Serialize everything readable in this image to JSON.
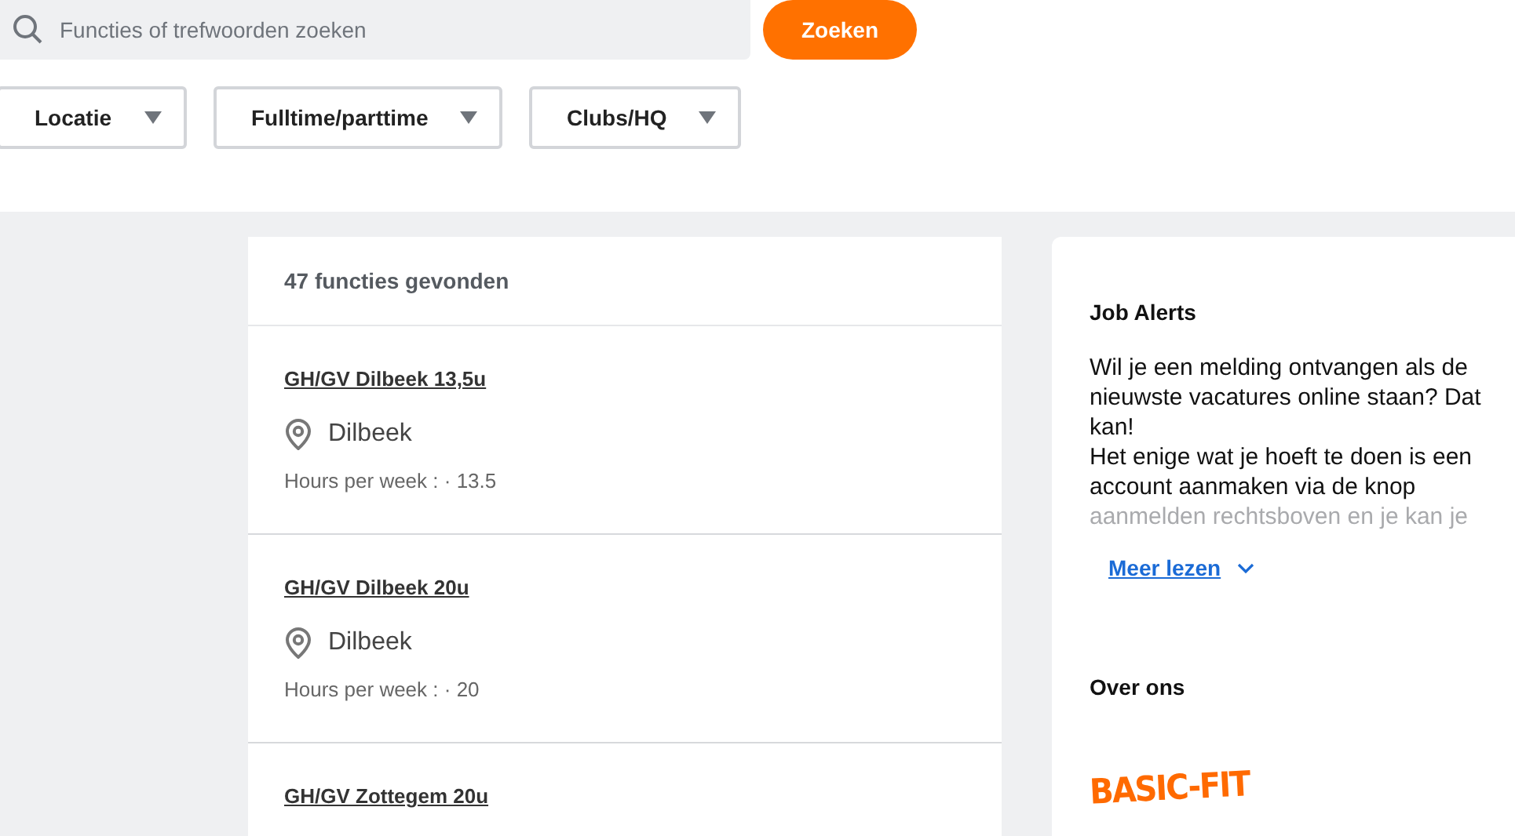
{
  "search": {
    "placeholder": "Functies of trefwoorden zoeken",
    "button": "Zoeken"
  },
  "filters": [
    {
      "label": "Locatie"
    },
    {
      "label": "Fulltime/parttime"
    },
    {
      "label": "Clubs/HQ"
    }
  ],
  "results": {
    "count": "47 functies gevonden",
    "jobs": [
      {
        "title": "GH/GV Dilbeek 13,5u",
        "location": "Dilbeek",
        "hours": "Hours per week : · 13.5"
      },
      {
        "title": "GH/GV Dilbeek 20u",
        "location": "Dilbeek",
        "hours": "Hours per week : · 20"
      },
      {
        "title": "GH/GV Zottegem 20u"
      }
    ]
  },
  "sidebar": {
    "job_alerts": {
      "title": "Job Alerts",
      "lines": [
        "Wil je een melding ontvangen als de nieuwste vacatures online staan? Dat kan!",
        "Het enige wat je hoeft te doen is een account aanmaken via de knop"
      ],
      "faded_line": "aanmelden rechtsboven en je kan je",
      "more": "Meer lezen"
    },
    "about": {
      "title": "Over ons",
      "logo": "BASIC-FIT"
    }
  }
}
